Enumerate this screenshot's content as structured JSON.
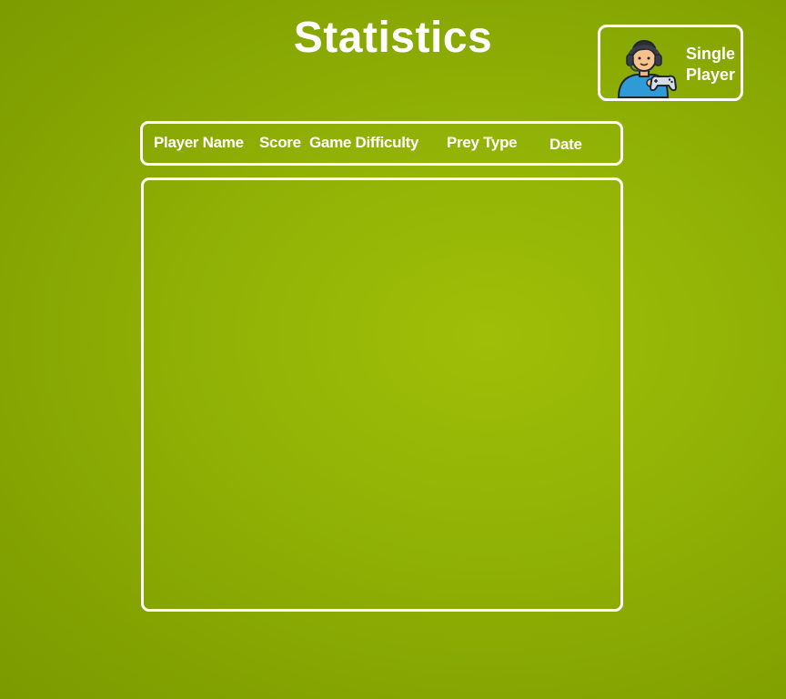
{
  "page": {
    "title": "Statistics"
  },
  "mode_button": {
    "label_line1": "Single",
    "label_line2": "Player",
    "icon": "gamer-with-controller-icon"
  },
  "table": {
    "columns": [
      "Player Name",
      "Score",
      "Game Difficulty",
      "Prey Type",
      "Date"
    ],
    "rows": []
  },
  "colors": {
    "background": "#8fae04",
    "border": "#ffffff",
    "text": "#ffffff"
  }
}
